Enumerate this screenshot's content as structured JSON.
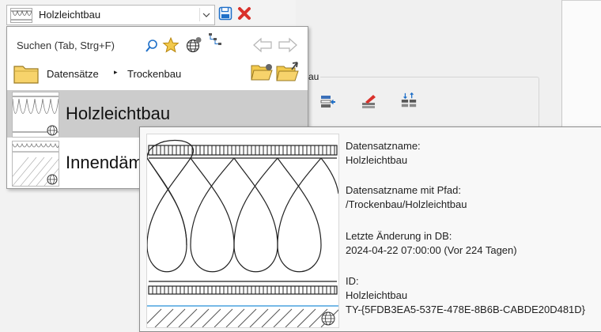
{
  "combo": {
    "selected_value": "Holzleichtbau",
    "thumbnail_icon": "insulation-thumbnail",
    "dropdown_icon": "chevron-down-icon"
  },
  "toolbar": {
    "save_icon": "save-icon",
    "delete_icon": "delete-x-icon"
  },
  "popup": {
    "search_label": "Suchen (Tab, Strg+F)",
    "icons": [
      "search-icon",
      "favorite-star-icon",
      "globe-settings-icon",
      "tree-view-icon",
      "back-arrow-icon",
      "forward-arrow-icon"
    ],
    "breadcrumb": {
      "root": "Datensätze",
      "separator": "▸",
      "current": "Trockenbau"
    },
    "breadcrumb_icons": [
      "open-folder-icon",
      "folder-upload-icon"
    ],
    "items": [
      {
        "label": "Holzleichtbau",
        "selected": true
      },
      {
        "label": "Innendämmung",
        "selected": false
      }
    ]
  },
  "background": {
    "group_label": "au",
    "toolbar_icons": [
      "layer-insert-icon",
      "layer-edit-icon",
      "layer-sort-icon"
    ]
  },
  "tooltip": {
    "name_label": "Datensatzname:",
    "name_value": "Holzleichtbau",
    "path_label": "Datensatzname mit Pfad:",
    "path_value": "/Trockenbau/Holzleichtbau",
    "modified_label": "Letzte Änderung in DB:",
    "modified_value": "2024-04-22 07:00:00 (Vor 224 Tagen)",
    "id_label": "ID:",
    "id_name": "Holzleichtbau",
    "id_value": "TY-{5FDB3EA5-537E-478E-8B6B-CABDE20D481D}"
  },
  "colors": {
    "selection": "#cccccc",
    "accent_blue": "#1e6fc8",
    "delete_red": "#d9312b",
    "folder_yellow": "#f2c94c"
  }
}
